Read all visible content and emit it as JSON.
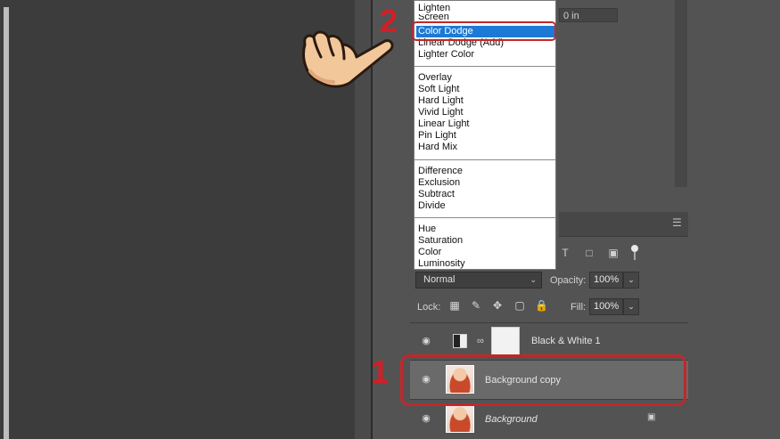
{
  "canvas": {},
  "properties": {
    "field_value": "0 in"
  },
  "blend_menu": {
    "groups": [
      [
        "Lighten",
        "Screen",
        "Color Dodge",
        "Linear Dodge (Add)",
        "Lighter Color"
      ],
      [
        "Overlay",
        "Soft Light",
        "Hard Light",
        "Vivid Light",
        "Linear Light",
        "Pin Light",
        "Hard Mix"
      ],
      [
        "Difference",
        "Exclusion",
        "Subtract",
        "Divide"
      ],
      [
        "Hue",
        "Saturation",
        "Color",
        "Luminosity"
      ]
    ],
    "selected": "Color Dodge"
  },
  "layers_panel": {
    "blend_mode": "Normal",
    "opacity_label": "Opacity:",
    "opacity_value": "100%",
    "lock_label": "Lock:",
    "fill_label": "Fill:",
    "fill_value": "100%",
    "layers": [
      {
        "name": "Black & White 1",
        "italic": false
      },
      {
        "name": "Background copy",
        "italic": false
      },
      {
        "name": "Background",
        "italic": true
      }
    ]
  },
  "annotations": {
    "step1": "1",
    "step2": "2"
  },
  "colors": {
    "highlight": "#c0282b",
    "selection": "#1c7ad6",
    "step_text": "#d11f26"
  },
  "icons": [
    "eye-icon",
    "adjustment-icon",
    "chain-link-icon",
    "lock-icon",
    "hand-pointer-icon",
    "panel-menu-icon"
  ]
}
